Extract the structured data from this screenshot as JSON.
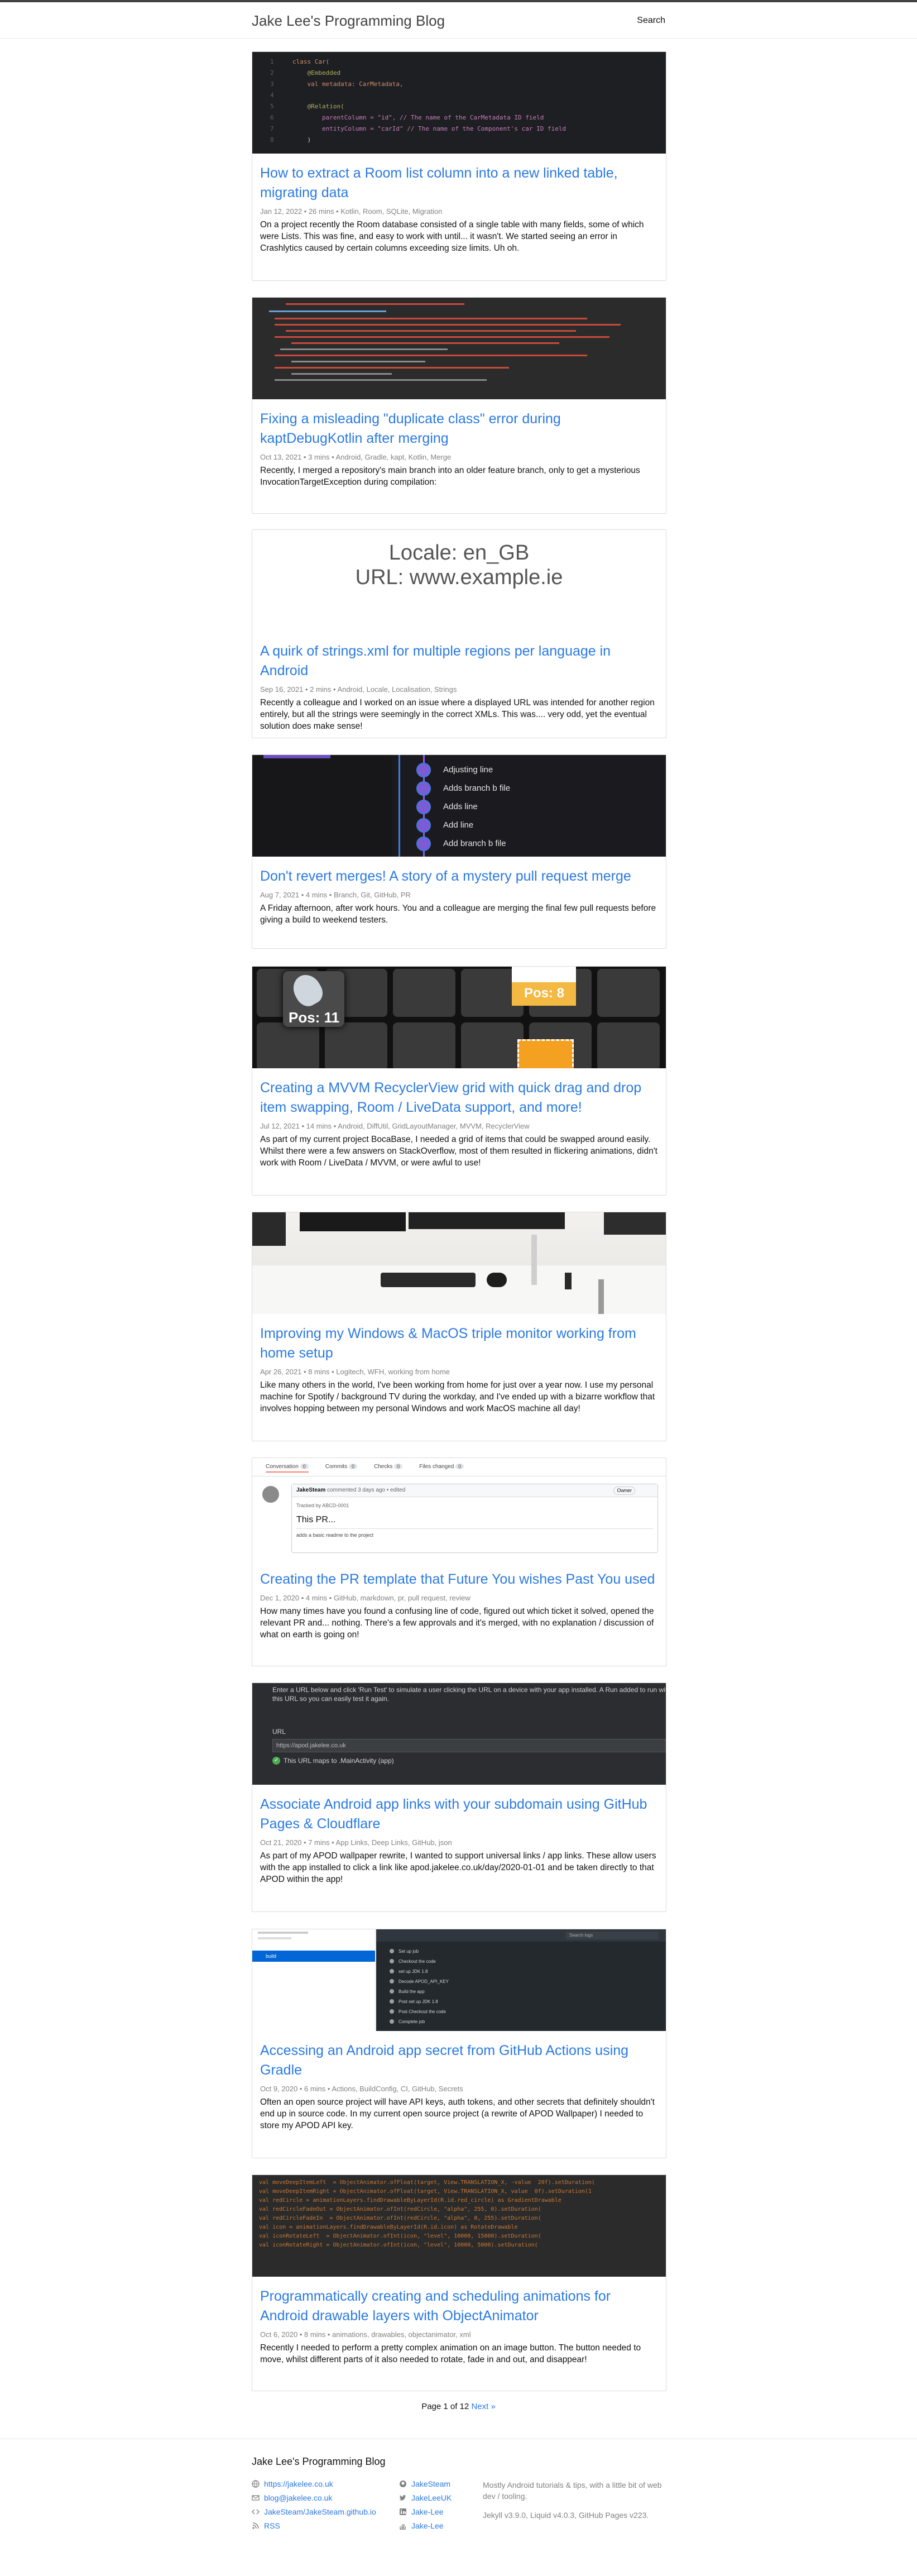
{
  "site": {
    "title": "Jake Lee's Programming Blog",
    "nav_search": "Search"
  },
  "posts": [
    {
      "title": "How to extract a Room list column into a new linked table, migrating data",
      "meta": "Jan 12, 2022 • 26 mins • Kotlin, Room, SQLite, Migration",
      "excerpt": "On a project recently the Room database consisted of a single table with many fields, some of which were Lists. This was fine, and easy to work with until... it wasn't. We started seeing an error in Crashlytics caused by certain columns exceeding size limits. Uh oh."
    },
    {
      "title": "Fixing a misleading \"duplicate class\" error during kaptDebugKotlin after merging",
      "meta": "Oct 13, 2021 • 3 mins • Android, Gradle, kapt, Kotlin, Merge",
      "excerpt": "Recently, I merged a repository's main branch into an older feature branch, only to get a mysterious InvocationTargetException during compilation:"
    },
    {
      "title": "A quirk of strings.xml for multiple regions per language in Android",
      "meta": "Sep 16, 2021 • 2 mins • Android, Locale, Localisation, Strings",
      "excerpt": "Recently a colleague and I worked on an issue where a displayed URL was intended for another region entirely, but all the strings were seemingly in the correct XMLs. This was.... very odd, yet the eventual solution does make sense!"
    },
    {
      "title": "Don't revert merges! A story of a mystery pull request merge",
      "meta": "Aug 7, 2021 • 4 mins • Branch, Git, GitHub, PR",
      "excerpt": "A Friday afternoon, after work hours. You and a colleague are merging the final few pull requests before giving a build to weekend testers."
    },
    {
      "title": "Creating a MVVM RecyclerView grid with quick drag and drop item swapping, Room / LiveData support, and more!",
      "meta": "Jul 12, 2021 • 14 mins • Android, DiffUtil, GridLayoutManager, MVVM, RecyclerView",
      "excerpt": "As part of my current project BocaBase, I needed a grid of items that could be swapped around easily. Whilst there were a few answers on StackOverflow, most of them resulted in flickering animations, didn't work with Room / LiveData / MVVM, or were awful to use!"
    },
    {
      "title": "Improving my Windows & MacOS triple monitor working from home setup",
      "meta": "Apr 26, 2021 • 8 mins • Logitech, WFH, working from home",
      "excerpt": "Like many others in the world, I've been working from home for just over a year now. I use my personal machine for Spotify / background TV during the workday, and I've ended up with a bizarre workflow that involves hopping between my personal Windows and work MacOS machine all day!"
    },
    {
      "title": "Creating the PR template that Future You wishes Past You used",
      "meta": "Dec 1, 2020 • 4 mins • GitHub, markdown, pr, pull request, review",
      "excerpt": "How many times have you found a confusing line of code, figured out which ticket it solved, opened the relevant PR and... nothing. There's a few approvals and it's merged, with no explanation / discussion of what on earth is going on!"
    },
    {
      "title": "Associate Android app links with your subdomain using GitHub Pages & Cloudflare",
      "meta": "Oct 21, 2020 • 7 mins • App Links, Deep Links, GitHub, json",
      "excerpt": "As part of my APOD wallpaper rewrite, I wanted to support universal links / app links. These allow users with the app installed to click a link like apod.jakelee.co.uk/day/2020-01-01 and be taken directly to that APOD within the app!"
    },
    {
      "title": "Accessing an Android app secret from GitHub Actions using Gradle",
      "meta": "Oct 9, 2020 • 6 mins • Actions, BuildConfig, CI, GitHub, Secrets",
      "excerpt": "Often an open source project will have API keys, auth tokens, and other secrets that definitely shouldn't end up in source code. In my current open source project (a rewrite of APOD Wallpaper) I needed to store my APOD API key."
    },
    {
      "title": "Programmatically creating and scheduling animations for Android drawable layers with ObjectAnimator",
      "meta": "Oct 6, 2020 • 8 mins • animations, drawables, objectanimator, xml",
      "excerpt": "Recently I needed to perform a pretty complex animation on an image button. The button needed to move, whilst different parts of it also needed to rotate, fade in and out, and disappear!"
    }
  ],
  "thumbs": {
    "room_code": [
      {
        "n": "1",
        "t": "class Car("
      },
      {
        "n": "2",
        "t": "    @Embedded"
      },
      {
        "n": "3",
        "t": "    val metadata: CarMetadata,"
      },
      {
        "n": "4",
        "t": ""
      },
      {
        "n": "5",
        "t": "    @Relation("
      },
      {
        "n": "6",
        "t": "        parentColumn = \"id\", // The name of the CarMetadata ID field"
      },
      {
        "n": "7",
        "t": "        entityColumn = \"carId\" // The name of the Component's car ID field"
      },
      {
        "n": "8",
        "t": "    )"
      }
    ],
    "locale_line": "Locale: en_GB",
    "url_line": "URL: www.example.ie",
    "git_lines": [
      "Adjusting line",
      "Adds branch b file",
      "Adds line",
      "Add line",
      "Add branch b file"
    ],
    "pos_left": "Pos: 11",
    "pos_right": "Pos: 8",
    "pr_tabs": [
      "Conversation",
      "Commits",
      "Checks",
      "Files changed"
    ],
    "pr_counts": [
      "0",
      "0",
      "0",
      "0"
    ],
    "pr_user": "JakeSteam",
    "pr_commented": "commented 3 days ago • edited",
    "pr_owner": "Owner",
    "pr_tracked": "Tracked by ABCD-0001",
    "pr_heading": "This PR...",
    "pr_desc": "adds a basic readme to the project",
    "applink_intro": "Enter a URL below and click 'Run Test' to simulate a user clicking the URL on a device with your app installed. A Run added to run with this URL so you can easily test it again.",
    "applink_label": "URL",
    "applink_value": "https://apod.jakelee.co.uk",
    "applink_result": "This URL maps to .MainActivity (app)",
    "actions_search": "Search logs",
    "actions_branch": "build",
    "actions_steps": [
      "Set up job",
      "Checkout the code",
      "set up JDK 1.8",
      "Decode APOD_API_KEY",
      "Build the app",
      "Post set up JDK 1.8",
      "Post Checkout the code",
      "Complete job"
    ],
    "anim_code": [
      "val moveDeepItemLeft  = ObjectAnimator.ofFloat(target, View.TRANSLATION_X, -value  20f).setDuration(",
      "val moveDeepItemRight = ObjectAnimator.ofFloat(target, View.TRANSLATION_X, value  0f).setDuration(1",
      "",
      "val redCircle = animationLayers.findDrawableByLayerId(R.id.red_circle) as GradientDrawable",
      "val redCircleFadeOut = ObjectAnimator.ofInt(redCircle, \"alpha\", 255, 0).setDuration(",
      "val redCircleFadeIn  = ObjectAnimator.ofInt(redCircle, \"alpha\", 0, 255).setDuration(",
      "",
      "val icon = animationLayers.findDrawableByLayerId(R.id.icon) as RotateDrawable",
      "val iconRotateLeft  = ObjectAnimator.ofInt(icon, \"level\", 10000, 15000).setDuration(",
      "val iconRotateRight = ObjectAnimator.ofInt(icon, \"level\", 10000, 5000).setDuration("
    ]
  },
  "pagination": {
    "text": "Page 1 of 12",
    "next": "Next »"
  },
  "footer": {
    "heading": "Jake Lee's Programming Blog",
    "links_left": [
      "https://jakelee.co.uk",
      "blog@jakelee.co.uk",
      "JakeSteam/JakeSteam.github.io",
      "RSS"
    ],
    "links_mid": [
      "JakeSteam",
      "JakeLeeUK",
      "Jake-Lee",
      "Jake-Lee"
    ],
    "desc1": "Mostly Android tutorials & tips, with a little bit of web dev / tooling.",
    "desc2": "Jekyll v3.9.0, Liquid v4.0.3, GitHub Pages v223."
  },
  "colors": {
    "link": "#2a7ae2",
    "meta": "#828282",
    "border": "#dcdcdc",
    "code_bg": "#1e1f22",
    "terminal_bg": "#2b2b2b"
  }
}
